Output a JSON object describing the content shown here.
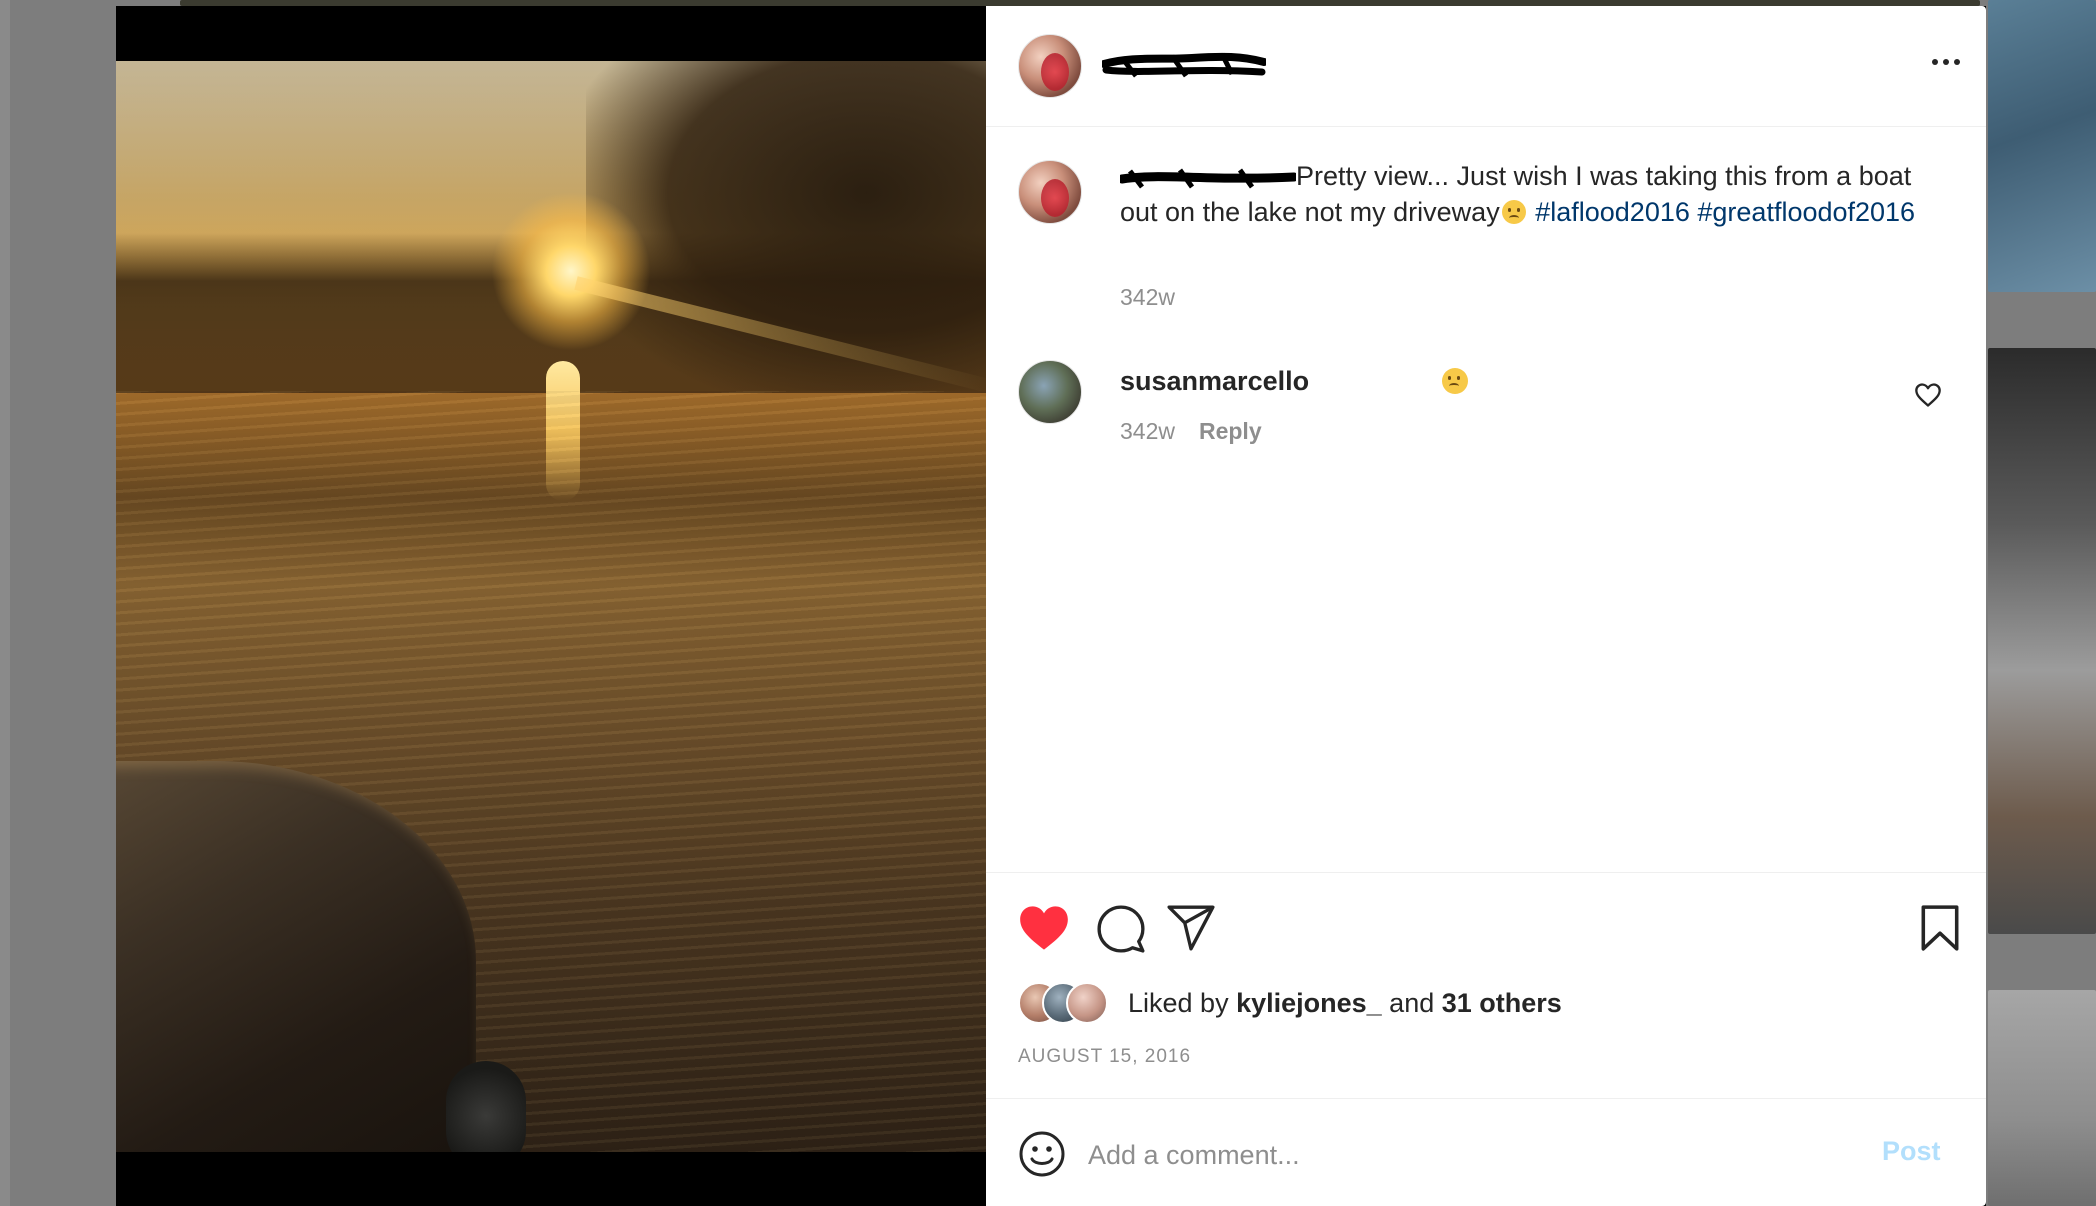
{
  "header": {
    "more_label": "..."
  },
  "caption": {
    "text": "Pretty view... Just wish I was taking this from a boat out on the lake not my driveway",
    "hashtags": [
      "#laflood2016",
      "#greatfloodof2016"
    ],
    "time": "342w"
  },
  "comment": {
    "username": "susanmarcello",
    "time": "342w",
    "reply_label": "Reply"
  },
  "likes": {
    "prefix": "Liked by ",
    "first_liker": "kyliejones_",
    "middle": " and ",
    "others": "31 others"
  },
  "post_date": "AUGUST 15, 2016",
  "comment_box": {
    "placeholder": "Add a comment...",
    "post_label": "Post"
  },
  "icons": {
    "like": "heart-filled-icon",
    "comment": "comment-bubble-icon",
    "share": "paper-plane-icon",
    "save": "bookmark-icon",
    "emoji": "smiley-icon",
    "more": "ellipsis-icon"
  },
  "colors": {
    "like_red": "#ff3040",
    "hashtag_blue": "#00376b",
    "post_button_disabled": "#b2dffc",
    "secondary_text": "#8e8e8e"
  }
}
